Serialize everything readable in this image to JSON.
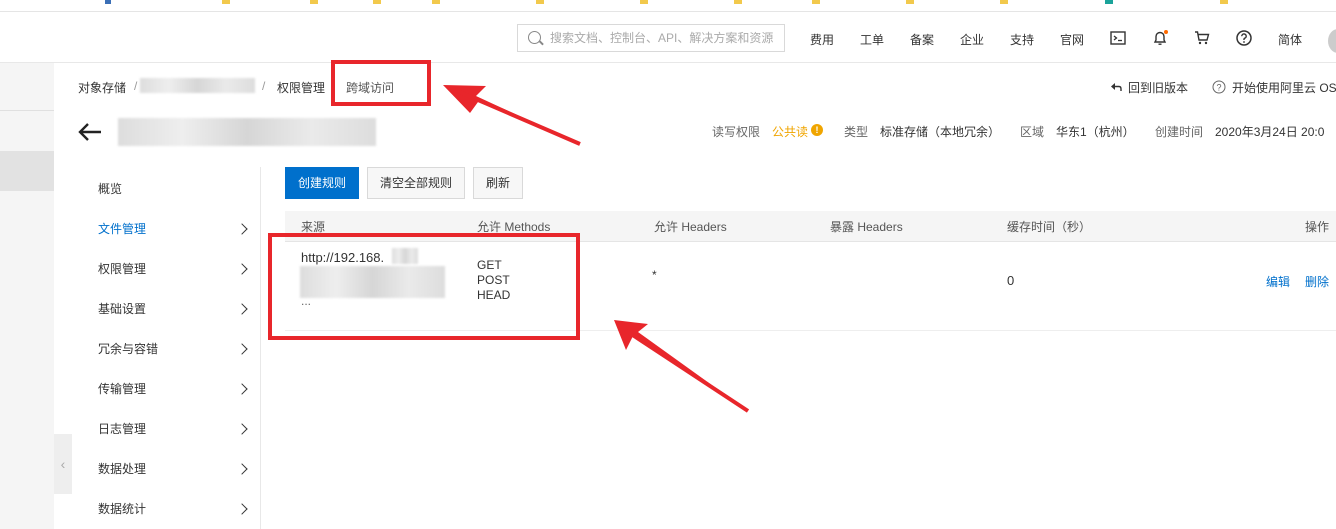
{
  "header": {
    "search_placeholder": "搜索文档、控制台、API、解决方案和资源",
    "nav": [
      "费用",
      "工单",
      "备案",
      "企业",
      "支持",
      "官网"
    ],
    "lang": "简体",
    "icons": [
      "terminal-icon",
      "bell-icon",
      "cart-icon",
      "help-icon"
    ]
  },
  "breadcrumb": {
    "root": "对象存储",
    "sep1": "/",
    "sep2": "/",
    "parent": "权限管理",
    "current": "跨域访问"
  },
  "top_actions": {
    "old_version": "回到旧版本",
    "start_using": "开始使用阿里云 OS"
  },
  "bucket": {
    "acl_label": "读写权限",
    "acl_value": "公共读",
    "type_label": "类型",
    "type_value": "标准存储（本地冗余）",
    "region_label": "区域",
    "region_value": "华东1（杭州）",
    "created_label": "创建时间",
    "created_value": "2020年3月24日 20:0"
  },
  "sidebar": {
    "items": [
      {
        "label": "概览",
        "active": false,
        "chevron": false
      },
      {
        "label": "文件管理",
        "active": true,
        "chevron": true
      },
      {
        "label": "权限管理",
        "active": false,
        "chevron": true
      },
      {
        "label": "基础设置",
        "active": false,
        "chevron": true
      },
      {
        "label": "冗余与容错",
        "active": false,
        "chevron": true
      },
      {
        "label": "传输管理",
        "active": false,
        "chevron": true
      },
      {
        "label": "日志管理",
        "active": false,
        "chevron": true
      },
      {
        "label": "数据处理",
        "active": false,
        "chevron": true
      },
      {
        "label": "数据统计",
        "active": false,
        "chevron": true
      }
    ]
  },
  "toolbar": {
    "create": "创建规则",
    "clear": "清空全部规则",
    "refresh": "刷新"
  },
  "table": {
    "headers": [
      "来源",
      "允许 Methods",
      "允许 Headers",
      "暴露 Headers",
      "缓存时间（秒）",
      "操作"
    ],
    "row": {
      "origin": "http://192.168.",
      "origin_more": "...",
      "methods": [
        "GET",
        "POST",
        "HEAD"
      ],
      "allow_headers": "*",
      "expose_headers": "",
      "max_age": "0",
      "edit": "编辑",
      "delete": "删除"
    }
  },
  "colors": {
    "accent": "#0070cc",
    "annotation_red": "#e8262b",
    "acl_orange": "#f0a500"
  }
}
